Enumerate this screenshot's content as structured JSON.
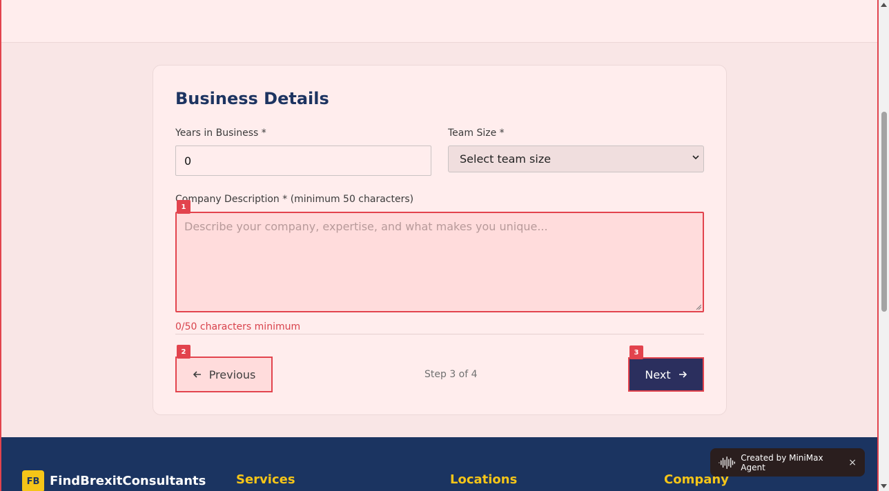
{
  "form": {
    "section_title": "Business Details",
    "years_label": "Years in Business *",
    "years_value": "0",
    "team_label": "Team Size *",
    "team_selected": "Select team size",
    "description_label": "Company Description * (minimum 50 characters)",
    "description_placeholder": "Describe your company, expertise, and what makes you unique...",
    "description_value": "",
    "char_count_error": "0/50 characters minimum"
  },
  "navigation": {
    "previous_label": "Previous",
    "step_text": "Step 3 of 4",
    "next_label": "Next"
  },
  "badges": [
    "1",
    "2",
    "3"
  ],
  "footer": {
    "logo_initials": "FB",
    "brand": "FindBrexitConsultants",
    "headings": [
      "Services",
      "Locations",
      "Company"
    ]
  },
  "toast": {
    "label": "Created by MiniMax Agent",
    "close": "×"
  },
  "colors": {
    "accent_red": "#e2434d",
    "navy": "#1b3461",
    "button_navy": "#2b2f5e",
    "gold": "#f5c518"
  },
  "icons": [
    "arrow-left-icon",
    "arrow-right-icon",
    "chevron-down-icon",
    "waveform-icon",
    "close-icon"
  ]
}
